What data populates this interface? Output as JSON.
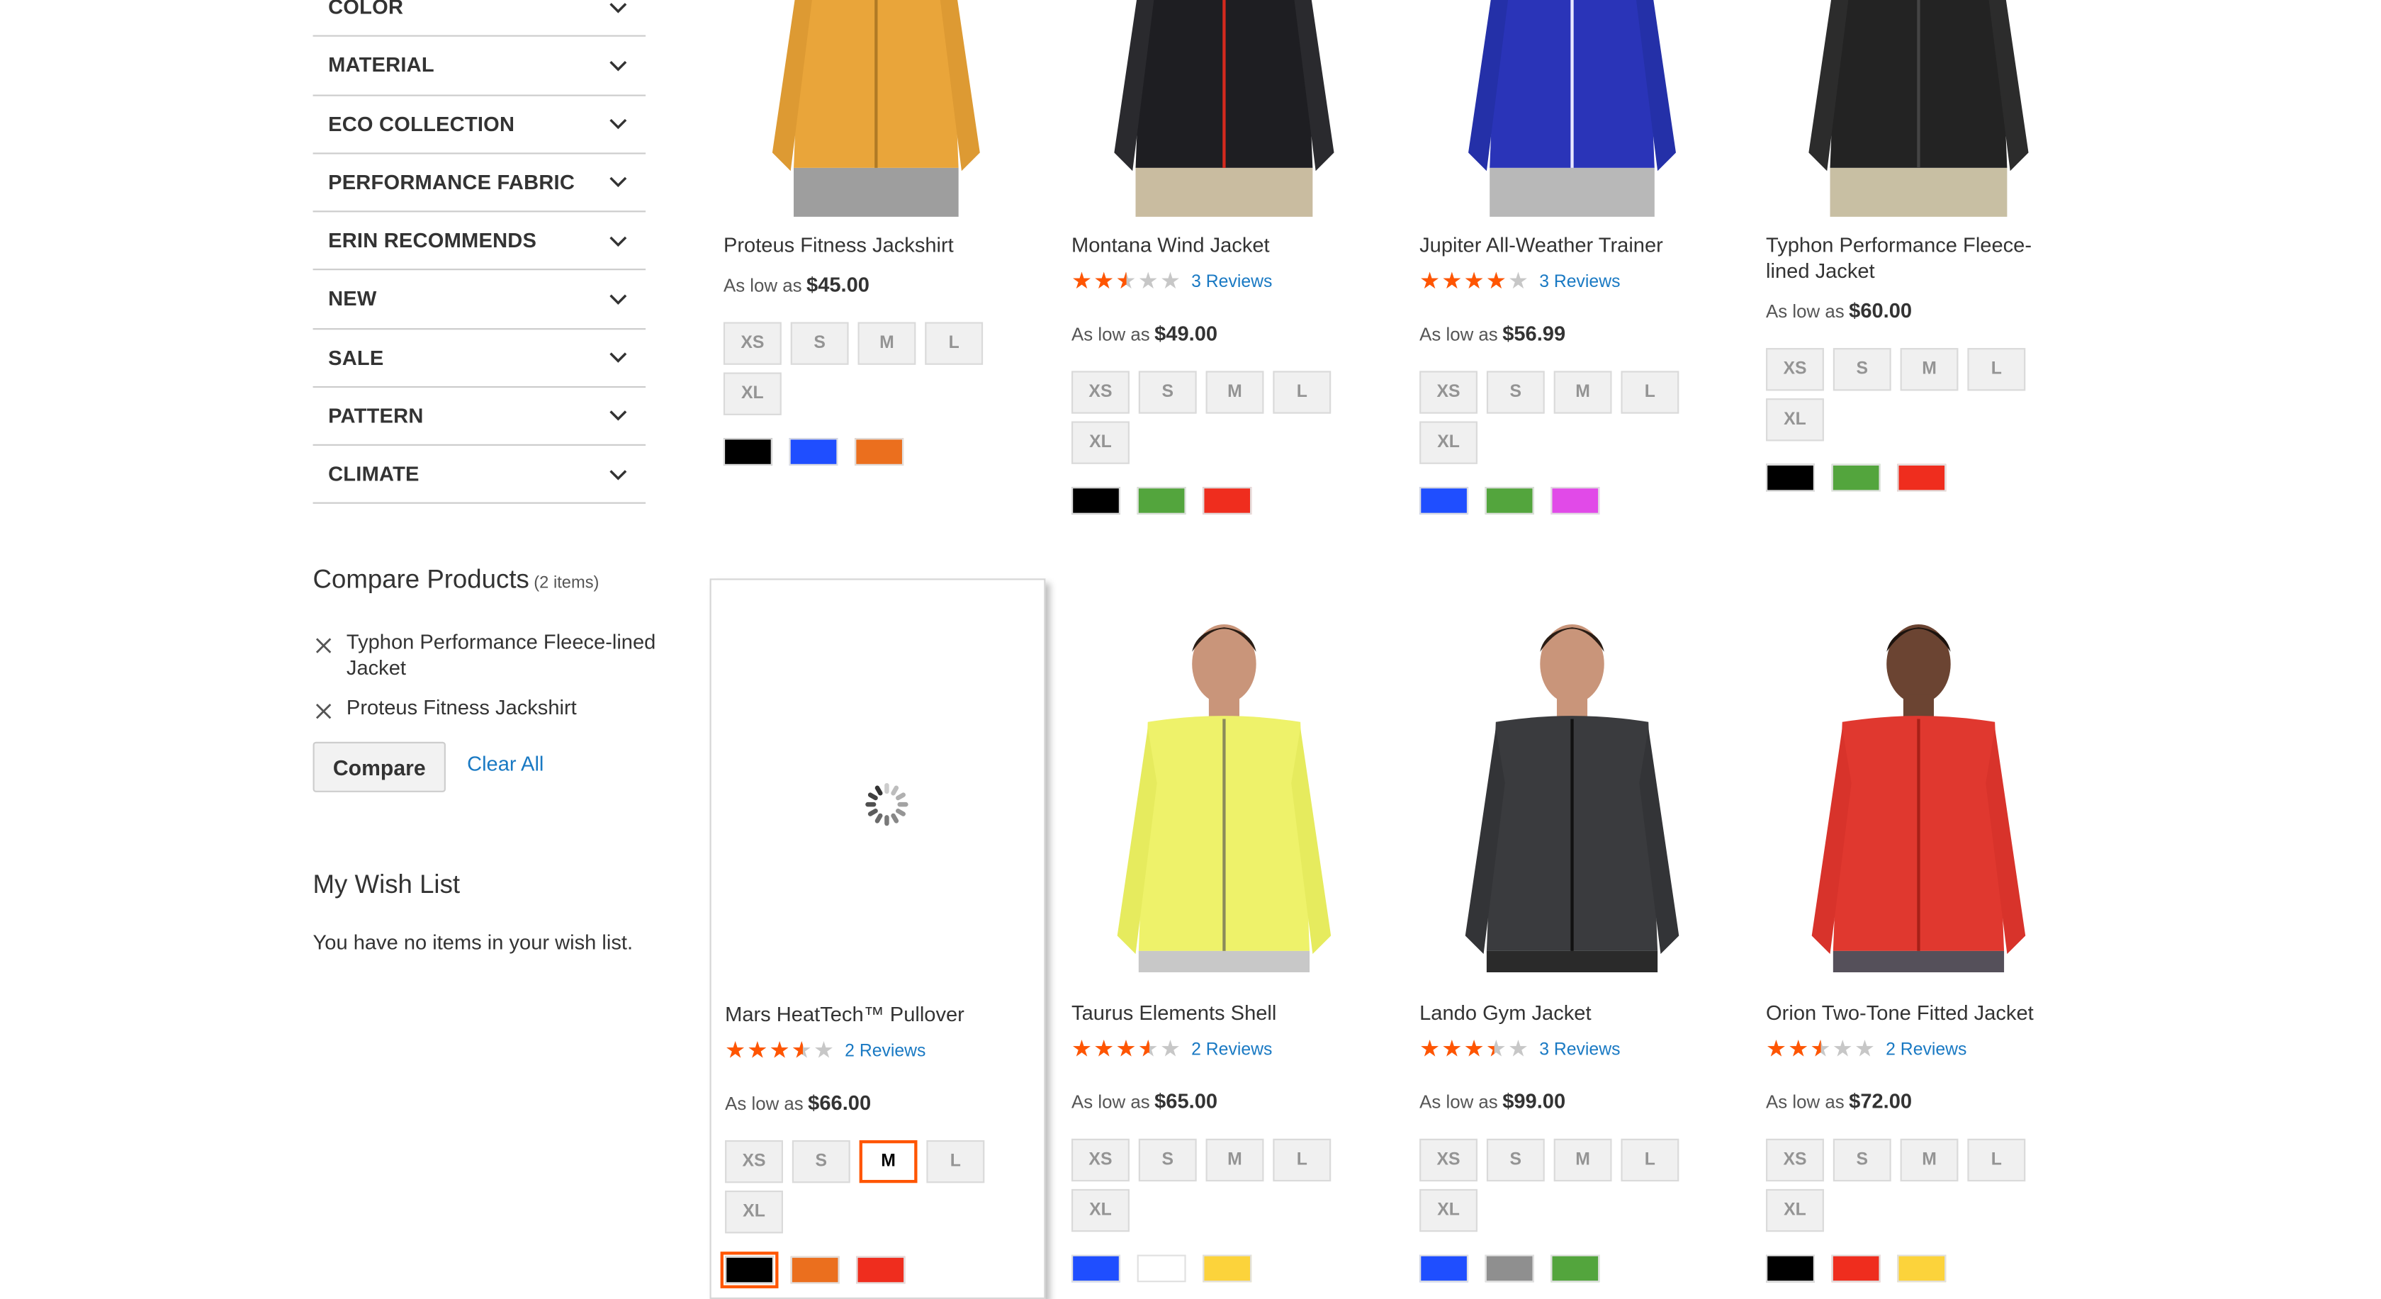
{
  "filters": [
    {
      "label": "COLOR"
    },
    {
      "label": "MATERIAL"
    },
    {
      "label": "ECO COLLECTION"
    },
    {
      "label": "PERFORMANCE FABRIC"
    },
    {
      "label": "ERIN RECOMMENDS"
    },
    {
      "label": "NEW"
    },
    {
      "label": "SALE"
    },
    {
      "label": "PATTERN"
    },
    {
      "label": "CLIMATE"
    }
  ],
  "compare": {
    "title": "Compare Products",
    "count": "(2 items)",
    "items": [
      {
        "name": "Typhon Performance Fleece-lined Jacket"
      },
      {
        "name": "Proteus Fitness Jackshirt"
      }
    ],
    "compare_button": "Compare",
    "clear_all": "Clear All"
  },
  "wishlist": {
    "title": "My Wish List",
    "empty_text": "You have no items in your wish list."
  },
  "price_prefix": "As low as",
  "products": [
    {
      "name": "Proteus Fitness Jackshirt",
      "rating_percent": null,
      "reviews": "",
      "price": "$45.00",
      "sizes": [
        "XS",
        "S",
        "M",
        "L",
        "XL"
      ],
      "selected_size": null,
      "colors": [
        "#000000",
        "#1f4eff",
        "#eb6f1e"
      ],
      "selected_color": null,
      "image": "orange-quarter-zip-shirt",
      "loading": false
    },
    {
      "name": "Montana Wind Jacket",
      "rating_percent": 50,
      "reviews": "3 Reviews",
      "price": "$49.00",
      "sizes": [
        "XS",
        "S",
        "M",
        "L",
        "XL"
      ],
      "selected_size": null,
      "colors": [
        "#000000",
        "#53a53d",
        "#ef2d1e"
      ],
      "selected_color": null,
      "image": "black-puffer-jacket",
      "loading": false
    },
    {
      "name": "Jupiter All-Weather Trainer",
      "rating_percent": 80,
      "reviews": "3 Reviews",
      "price": "$56.99",
      "sizes": [
        "XS",
        "S",
        "M",
        "L",
        "XL"
      ],
      "selected_size": null,
      "colors": [
        "#1f4eff",
        "#53a53d",
        "#e14ae8"
      ],
      "selected_color": null,
      "image": "blue-track-jacket",
      "loading": false
    },
    {
      "name": "Typhon Performance Fleece-lined Jacket",
      "rating_percent": null,
      "reviews": "",
      "price": "$60.00",
      "sizes": [
        "XS",
        "S",
        "M",
        "L",
        "XL"
      ],
      "selected_size": null,
      "colors": [
        "#000000",
        "#53a53d",
        "#ef2d1e"
      ],
      "selected_color": null,
      "image": "black-bomber-jacket",
      "loading": false
    },
    {
      "name": "Mars HeatTech™ Pullover",
      "rating_percent": 70,
      "reviews": "2 Reviews",
      "price": "$66.00",
      "sizes": [
        "XS",
        "S",
        "M",
        "L",
        "XL"
      ],
      "selected_size": "M",
      "colors": [
        "#000000",
        "#eb6f1e",
        "#ef2d1e"
      ],
      "selected_color": 0,
      "image": "loading",
      "loading": true
    },
    {
      "name": "Taurus Elements Shell",
      "rating_percent": 70,
      "reviews": "2 Reviews",
      "price": "$65.00",
      "sizes": [
        "XS",
        "S",
        "M",
        "L",
        "XL"
      ],
      "selected_size": null,
      "colors": [
        "#1f4eff",
        "#ffffff",
        "#fcd33b"
      ],
      "selected_color": null,
      "image": "yellow-pullover",
      "loading": false
    },
    {
      "name": "Lando Gym Jacket",
      "rating_percent": 67,
      "reviews": "3 Reviews",
      "price": "$99.00",
      "sizes": [
        "XS",
        "S",
        "M",
        "L",
        "XL"
      ],
      "selected_size": null,
      "colors": [
        "#1f4eff",
        "#8f8f8f",
        "#53a53d"
      ],
      "selected_color": null,
      "image": "charcoal-fleece-jacket",
      "loading": false
    },
    {
      "name": "Orion Two-Tone Fitted Jacket",
      "rating_percent": 50,
      "reviews": "2 Reviews",
      "price": "$72.00",
      "sizes": [
        "XS",
        "S",
        "M",
        "L",
        "XL"
      ],
      "selected_size": null,
      "colors": [
        "#000000",
        "#ef2d1e",
        "#fcd33b"
      ],
      "selected_color": null,
      "image": "red-fleece-jacket",
      "loading": false
    }
  ]
}
